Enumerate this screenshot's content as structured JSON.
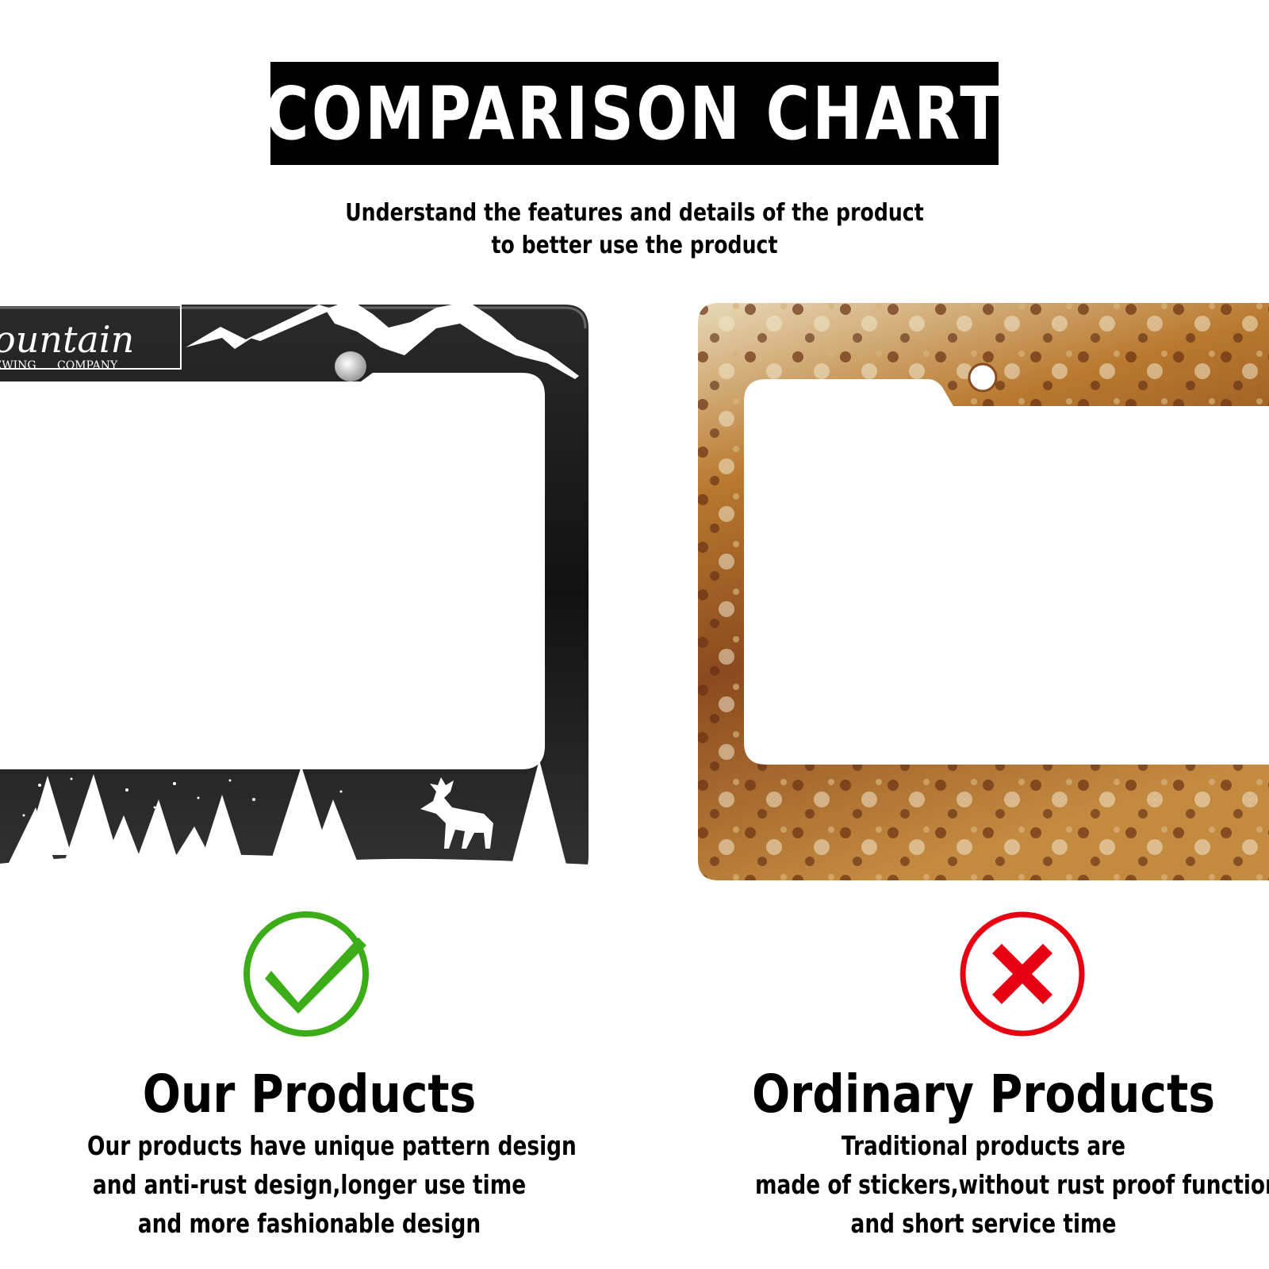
{
  "header": {
    "title": "COMPARISON CHART",
    "subtitle_line1": "Understand the features and details of the product",
    "subtitle_line2": "to better use the product"
  },
  "products": {
    "ours": {
      "heading": "Our Products",
      "lines": [
        "Our products have unique pattern design",
        "and anti-rust design,longer use time",
        "and more fashionable design"
      ],
      "badge_icon": "check-circle-icon",
      "badge_color": "#3cad18",
      "frame_logo_text": "ountain",
      "frame_logo_sub1": "EWING",
      "frame_logo_sub2": "COMPANY"
    },
    "ordinary": {
      "heading": "Ordinary Products",
      "lines": [
        "Traditional products are",
        "made of stickers,without rust proof function",
        "and short service time"
      ],
      "badge_icon": "x-circle-icon",
      "badge_color": "#e60012"
    }
  }
}
